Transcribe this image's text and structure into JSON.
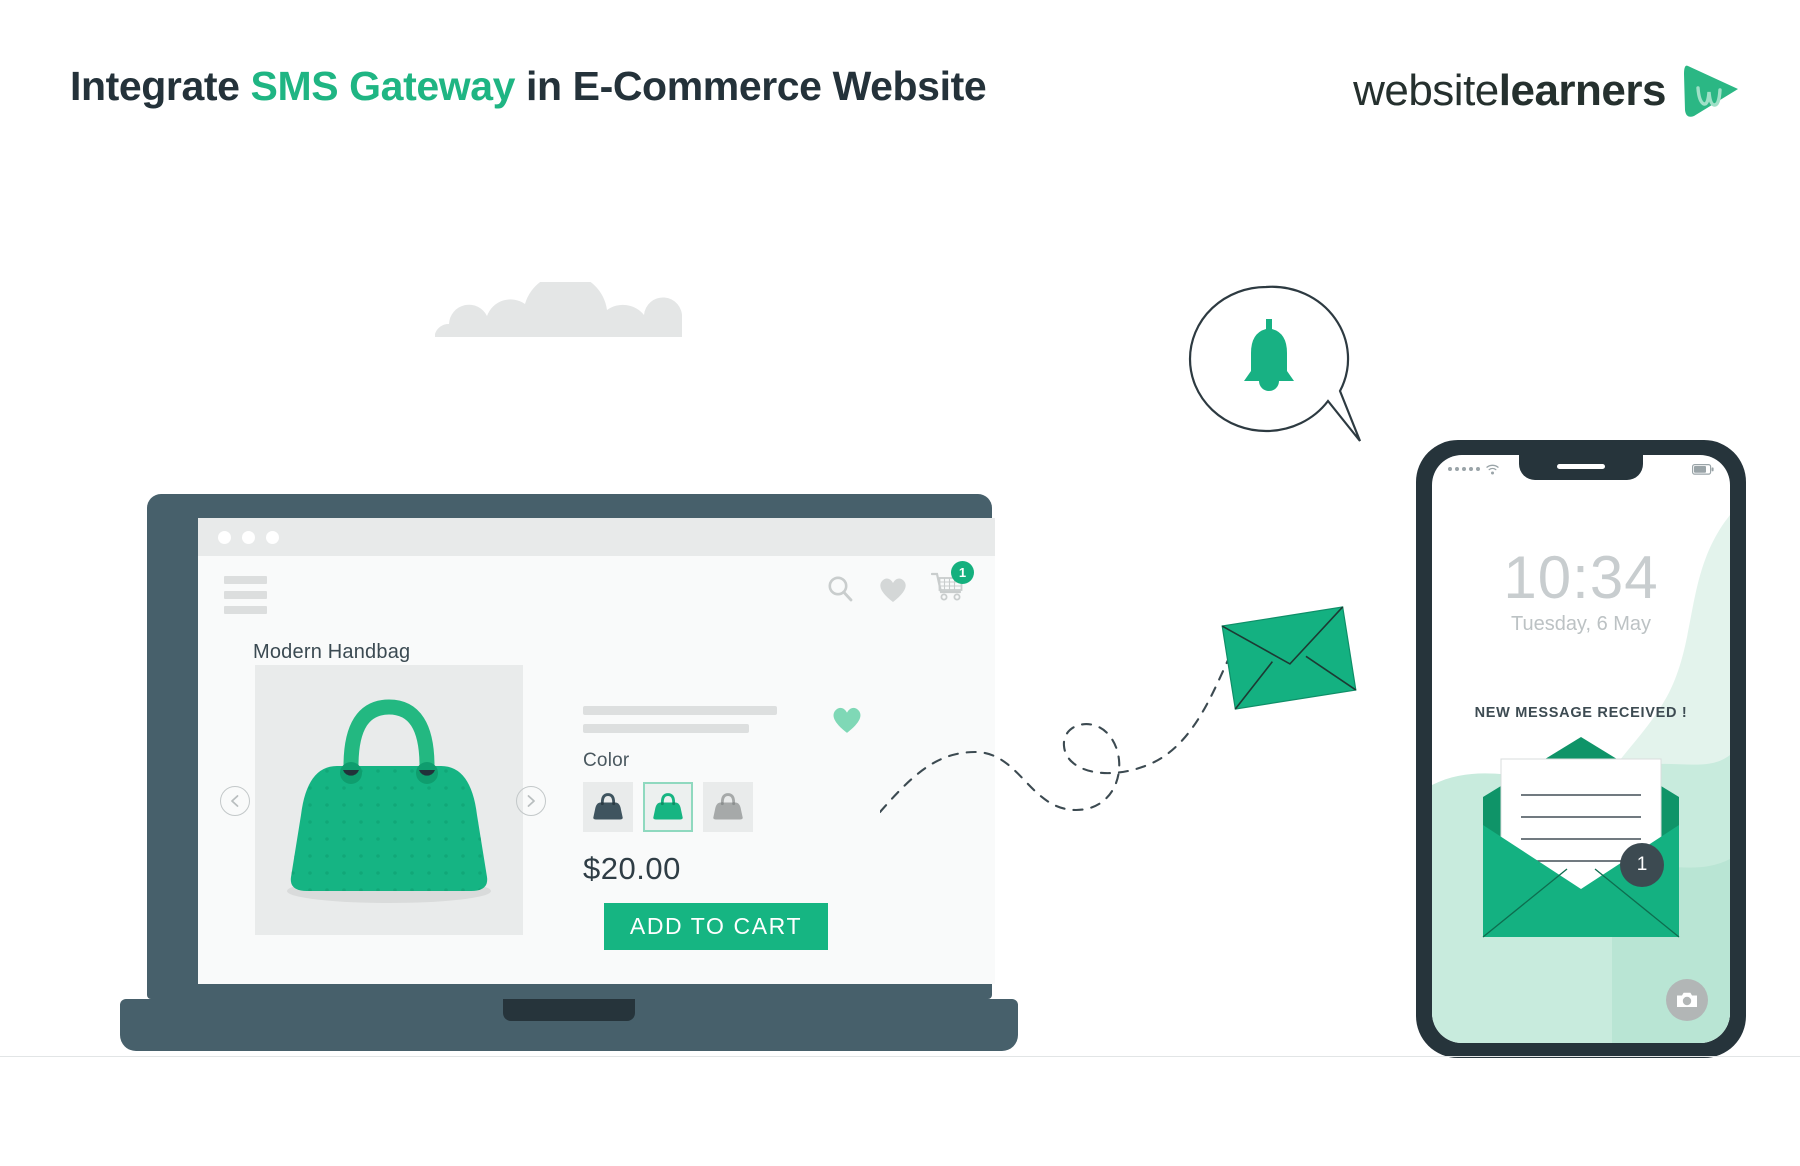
{
  "header": {
    "title_part1": "Integrate ",
    "title_accent": "SMS Gateway",
    "title_part2": " in E-Commerce Website",
    "logo_regular": "website",
    "logo_bold": "learners"
  },
  "colors": {
    "brand_green": "#16b582",
    "accent_green": "#1fb583",
    "dark_slate": "#47606b",
    "deep_slate": "#26343b",
    "mint_light": "#c8ebdd",
    "light_gray": "#e9ebeb",
    "text_dark": "#24323a"
  },
  "laptop": {
    "browser": {
      "dot_count": 3
    },
    "site_header": {
      "menu_icon": "hamburger-icon",
      "search_icon": "search-icon",
      "wishlist_icon": "heart-icon",
      "cart_icon": "cart-icon",
      "cart_badge_count": "1"
    },
    "product": {
      "title": "Modern Handbag",
      "color_label": "Color",
      "price": "$20.00",
      "add_to_cart_label": "ADD TO CART",
      "prev_arrow_icon": "chevron-left-icon",
      "next_arrow_icon": "chevron-right-icon",
      "favorite_icon": "heart-icon",
      "swatches": [
        {
          "name": "dark-slate",
          "color": "#3f545f",
          "selected": false
        },
        {
          "name": "green",
          "color": "#16b582",
          "selected": true
        },
        {
          "name": "gray",
          "color": "#a6a9a9",
          "selected": false
        }
      ]
    }
  },
  "notification": {
    "bell_icon": "bell-icon",
    "envelope_icon": "envelope-icon"
  },
  "phone": {
    "time": "10:34",
    "date": "Tuesday, 6 May",
    "message_banner": "NEW MESSAGE RECEIVED !",
    "badge_count": "1",
    "status": {
      "signal_icon": "signal-dots-icon",
      "wifi_icon": "wifi-icon",
      "battery_icon": "battery-icon"
    },
    "camera_icon": "camera-icon"
  }
}
